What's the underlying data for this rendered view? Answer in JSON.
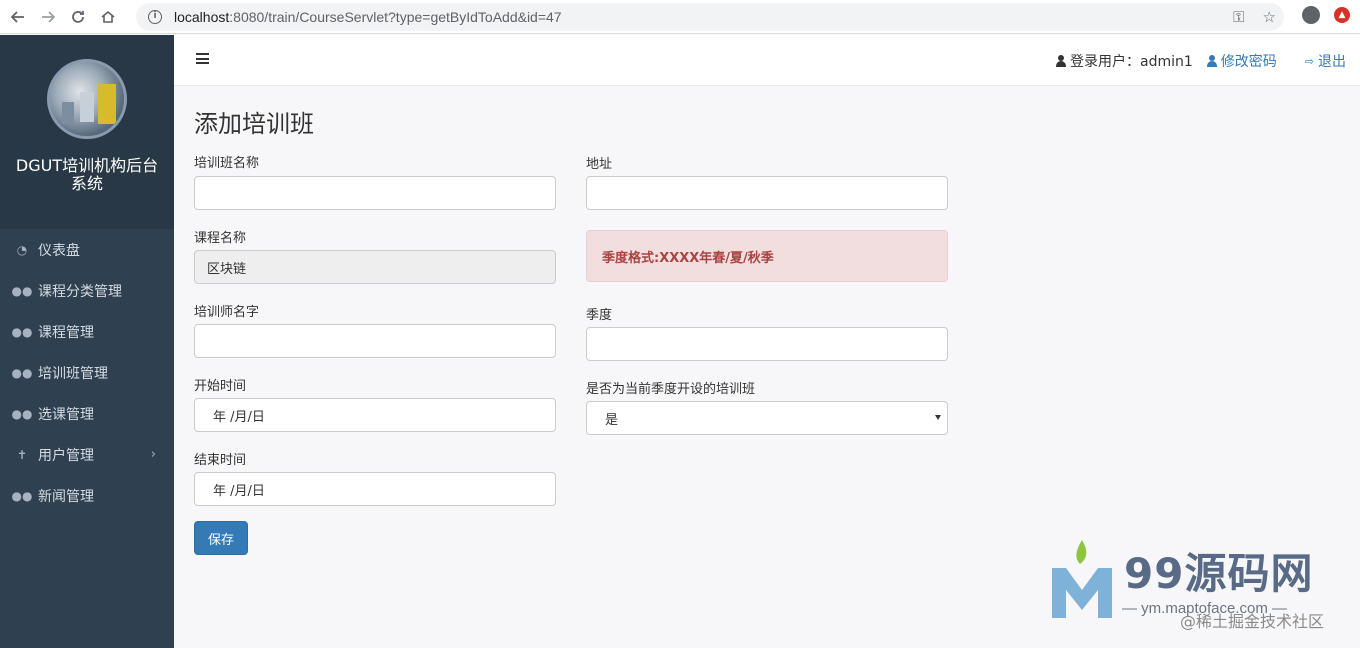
{
  "browser": {
    "url_host": "localhost",
    "url_rest": ":8080/train/CourseServlet?type=getByIdToAdd&id=47"
  },
  "sidebar": {
    "system_title": "DGUT培训机构后台系统",
    "items": [
      {
        "label": "仪表盘",
        "icon": "dashboard-icon"
      },
      {
        "label": "课程分类管理",
        "icon": "users-icon"
      },
      {
        "label": "课程管理",
        "icon": "users-icon"
      },
      {
        "label": "培训班管理",
        "icon": "users-icon"
      },
      {
        "label": "选课管理",
        "icon": "users-icon"
      },
      {
        "label": "用户管理",
        "icon": "pin-icon"
      },
      {
        "label": "新闻管理",
        "icon": "users-icon"
      }
    ]
  },
  "header": {
    "login_user": "登录用户：admin1",
    "change_password": "修改密码",
    "logout": "退出"
  },
  "page": {
    "title": "添加培训班"
  },
  "form": {
    "class_name_label": "培训班名称",
    "class_name_value": "",
    "course_name_label": "课程名称",
    "course_name_value": "区块链",
    "trainer_label": "培训师名字",
    "trainer_value": "",
    "start_label": "开始时间",
    "start_placeholder": "年 /月/日",
    "end_label": "结束时间",
    "end_placeholder": "年 /月/日",
    "address_label": "地址",
    "address_value": "",
    "season_alert": "季度格式:XXXX年春/夏/秋季",
    "season_label": "季度",
    "season_value": "",
    "current_label": "是否为当前季度开设的培训班",
    "current_value": "是",
    "save_label": "保存"
  },
  "watermark": {
    "brand": "99源码网",
    "url": "— ym.maptoface.com —",
    "juejin": "@稀土掘金技术社区"
  },
  "colors": {
    "sidebar_bg": "#2f4050",
    "primary": "#337ab7",
    "alert_bg": "#f2dede",
    "alert_text": "#a94442"
  }
}
